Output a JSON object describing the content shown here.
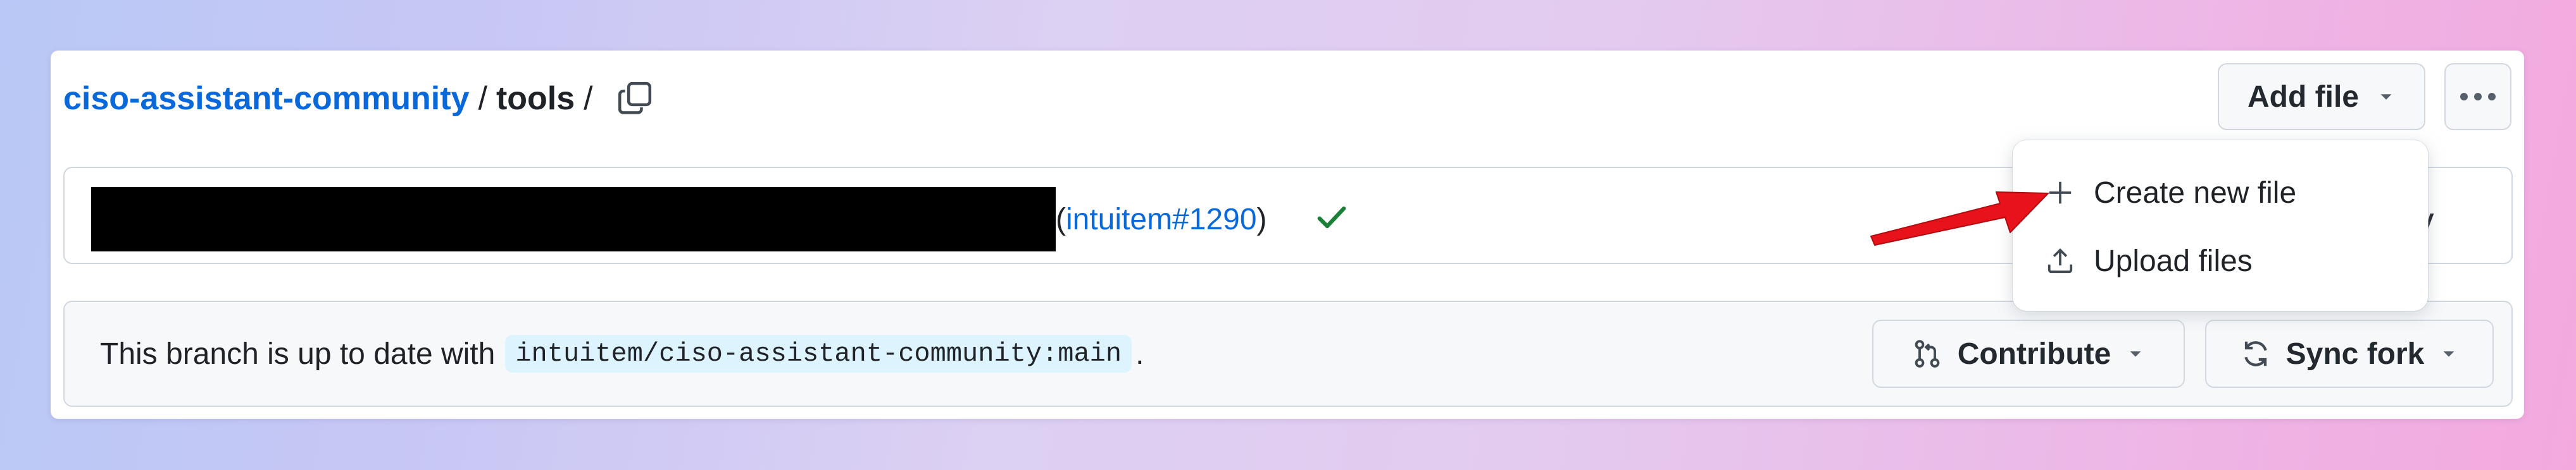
{
  "breadcrumb": {
    "repo": "ciso-assistant-community",
    "separator": "/",
    "directory": "tools",
    "trailing_separator": "/"
  },
  "header_actions": {
    "add_file_label": "Add file",
    "more_icon": "kebab-horizontal-icon"
  },
  "latest_commit": {
    "pr_open_paren": "(",
    "pr_link": "intuitem#1290",
    "pr_close_paren": ")",
    "status_icon": "check-icon",
    "status_color": "#1a7f37",
    "history_label_fragment": "tory"
  },
  "branch_status": {
    "text": "This branch is up to date with",
    "upstream_ref": "intuitem/ciso-assistant-community:main",
    "trailing": ".",
    "contribute_label": "Contribute",
    "sync_fork_label": "Sync fork"
  },
  "add_file_menu": {
    "items": [
      {
        "label": "Create new file",
        "icon": "plus-icon"
      },
      {
        "label": "Upload files",
        "icon": "upload-icon"
      }
    ]
  },
  "colors": {
    "link": "#0969da",
    "annotation_arrow": "#e8121b"
  }
}
